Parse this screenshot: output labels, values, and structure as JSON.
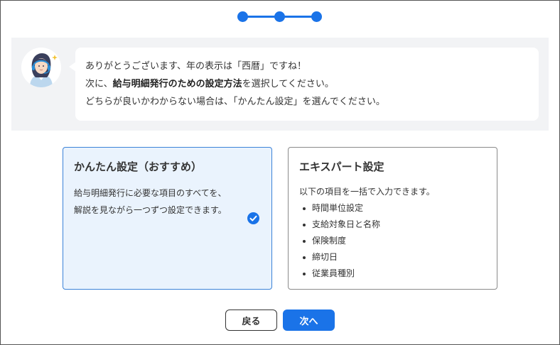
{
  "stepper": {
    "steps": 3,
    "current": 3,
    "color": "#1a73e8"
  },
  "message": {
    "line1": "ありがとうございます、年の表示は「西暦」ですね！",
    "line2_prefix": "次に、",
    "line2_bold": "給与明細発行のための設定方法",
    "line2_suffix": "を選択してください。",
    "line3": "どちらが良いかわからない場合は、「かんたん設定」を選んでください。"
  },
  "options": [
    {
      "title": "かんたん設定（おすすめ）",
      "desc_line1": "給与明細発行に必要な項目のすべてを、",
      "desc_line2": "解説を見ながら一つずつ設定できます。",
      "selected": true
    },
    {
      "title": "エキスパート設定",
      "desc": "以下の項目を一括で入力できます。",
      "items": [
        "時間単位設定",
        "支給対象日と名称",
        "保険制度",
        "締切日",
        "従業員種別"
      ],
      "selected": false
    }
  ],
  "buttons": {
    "back": "戻る",
    "next": "次へ"
  },
  "colors": {
    "accent": "#1a73e8",
    "selected_bg": "#eaf3fd",
    "band_bg": "#f2f3f5"
  }
}
